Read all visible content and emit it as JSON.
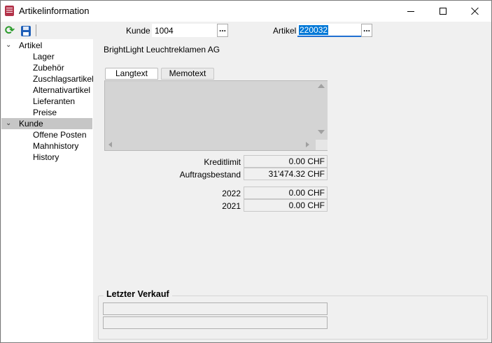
{
  "window": {
    "title": "Artikelinformation"
  },
  "toolbar": {
    "kunde_label": "Kunde",
    "kunde_value": "1004",
    "kunde_lookup": "...",
    "artikel_label": "Artikel",
    "artikel_value": "220032",
    "artikel_lookup": "..."
  },
  "tree": {
    "groups": [
      {
        "label": "Artikel",
        "expanded": true,
        "children": [
          "Lager",
          "Zubehör",
          "Zuschlagsartikel",
          "Alternativartikel",
          "Lieferanten",
          "Preise"
        ]
      },
      {
        "label": "Kunde",
        "expanded": true,
        "selected": true,
        "children": [
          "Offene Posten",
          "Mahnhistory",
          "History"
        ]
      }
    ]
  },
  "content": {
    "customer_name": "BrightLight Leuchtreklamen AG",
    "tabs": [
      {
        "label": "Langtext",
        "active": true
      },
      {
        "label": "Memotext",
        "active": false
      }
    ],
    "fields": [
      {
        "label": "Kreditlimit",
        "value": "0.00 CHF"
      },
      {
        "label": "Auftragsbestand",
        "value": "31'474.32 CHF"
      }
    ],
    "years": [
      {
        "label": "2022",
        "value": "0.00 CHF"
      },
      {
        "label": "2021",
        "value": "0.00 CHF"
      }
    ],
    "letzter_verkauf": {
      "title": "Letzter Verkauf",
      "line1": "",
      "line2": ""
    }
  },
  "icons": {
    "refresh": "refresh-icon",
    "save": "save-icon",
    "app": "app-icon"
  },
  "colors": {
    "selection": "#0078d7",
    "tree_selected": "#c6c6c6",
    "refresh": "#2a9a2a",
    "save": "#1f5fb8"
  }
}
